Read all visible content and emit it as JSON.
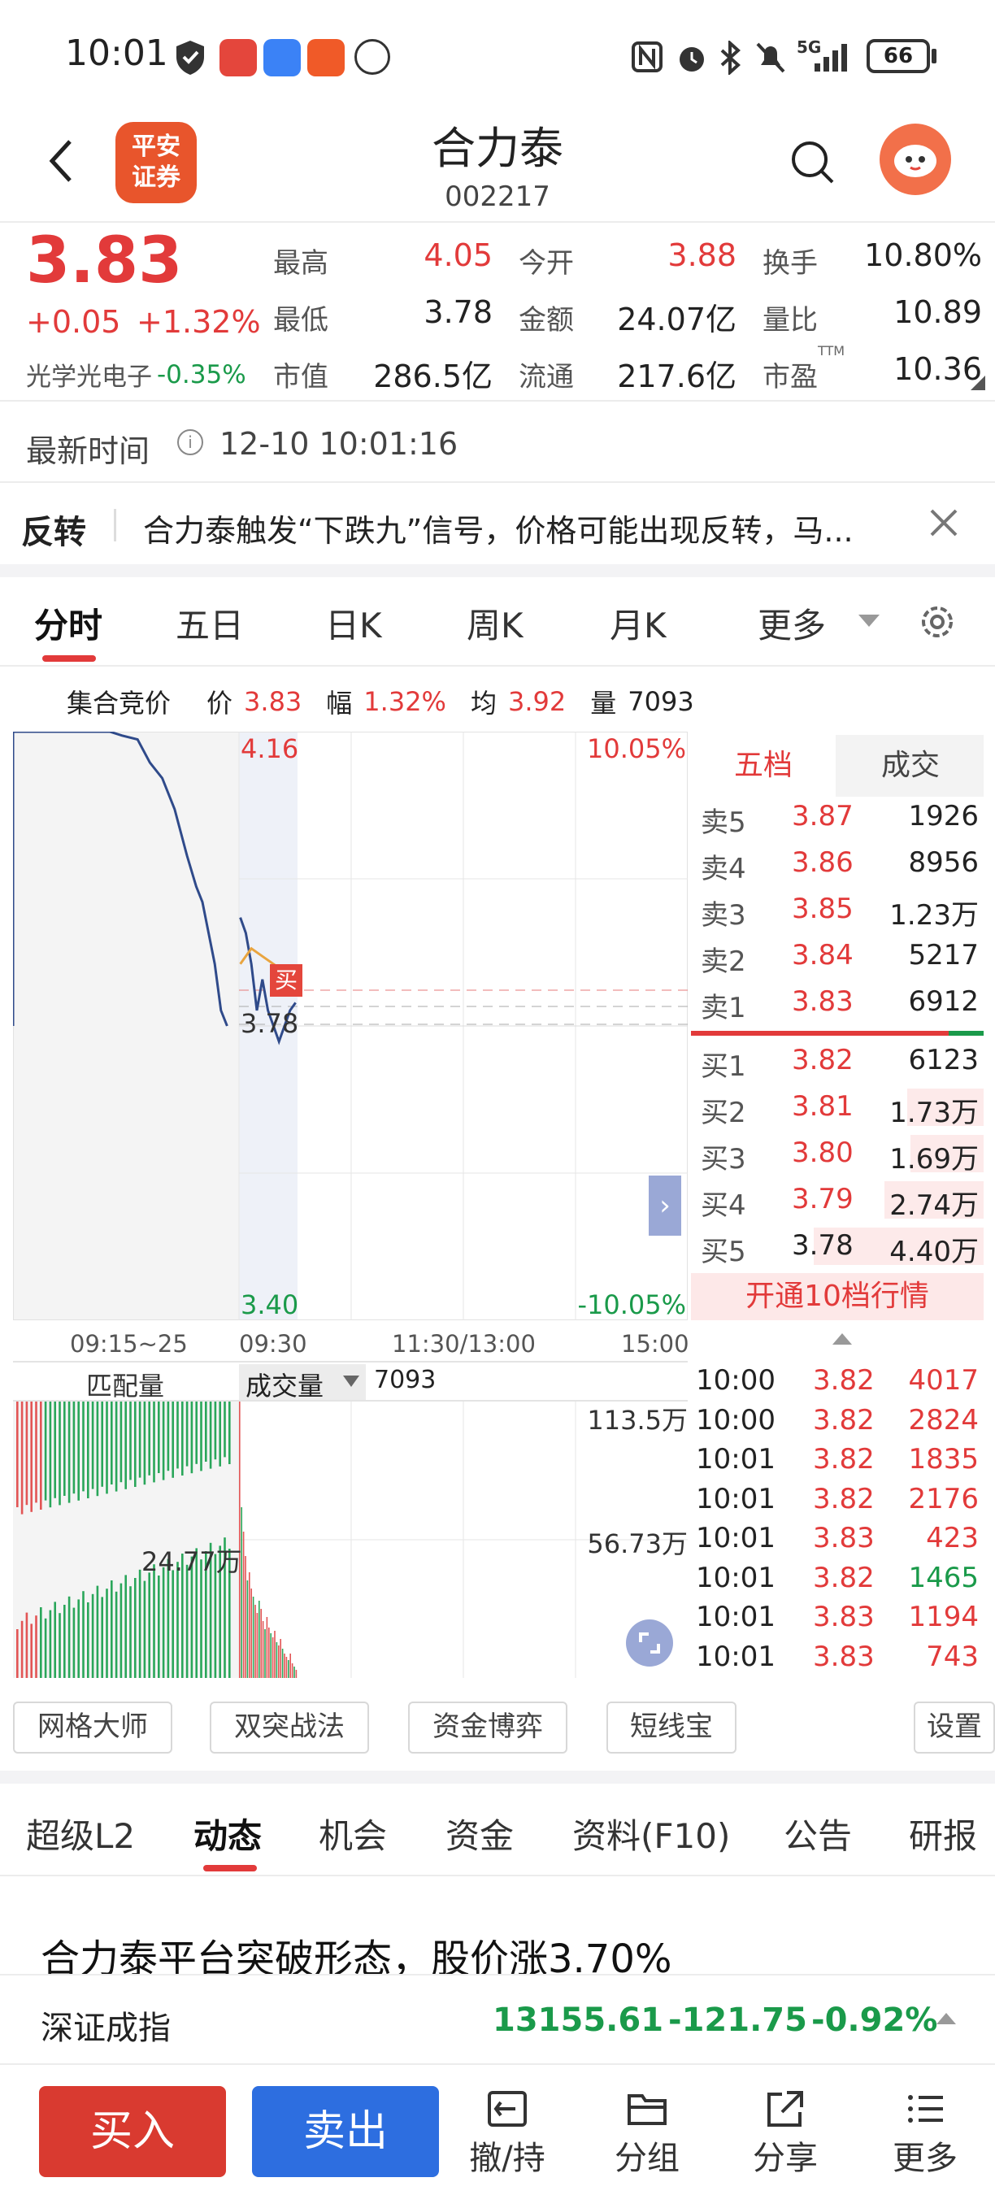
{
  "status_bar": {
    "time": "10:01",
    "battery": "66",
    "network": "5G"
  },
  "nav": {
    "stock_name": "合力泰",
    "stock_code": "002217",
    "logo_text_1": "平安",
    "logo_text_2": "证券"
  },
  "quote": {
    "price": "3.83",
    "change": "+0.05",
    "change_pct": "+1.32%",
    "sector_name": "光学光电子",
    "sector_pct": "-0.35%",
    "labels": {
      "high": "最高",
      "low": "最低",
      "mcap": "市值",
      "open": "今开",
      "amount": "金额",
      "float": "流通",
      "turnover": "换手",
      "vol_ratio": "量比",
      "pe": "市盈"
    },
    "values": {
      "high": "4.05",
      "low": "3.78",
      "mcap": "286.5亿",
      "open": "3.88",
      "amount": "24.07亿",
      "float": "217.6亿",
      "turnover": "10.80%",
      "vol_ratio": "10.89",
      "pe": "10.36"
    },
    "pe_superscript": "TTM",
    "latest_time_label": "最新时间",
    "latest_time": "12-10 10:01:16"
  },
  "news": {
    "tag": "反转",
    "text": "合力泰触发“下跌九”信号，价格可能出现反转，马..."
  },
  "chart_tabs": [
    "分时",
    "五日",
    "日K",
    "周K",
    "月K",
    "更多"
  ],
  "auction": {
    "label": "集合竞价",
    "price_label": "价",
    "price": "3.83",
    "pct_label": "幅",
    "pct": "1.32%",
    "avg_label": "均",
    "avg": "3.92",
    "vol_label": "量",
    "vol": "7093"
  },
  "chart_axis": {
    "top_price": "4.16",
    "top_pct": "10.05%",
    "bottom_price": "3.40",
    "bottom_pct": "-10.05%",
    "mark_price": "3.78",
    "buy_marker": "买",
    "times": [
      "09:15~25",
      "09:30",
      "11:30/13:00",
      "15:00"
    ]
  },
  "chart_data": {
    "type": "line",
    "title": "",
    "ylim": [
      3.4,
      4.16
    ],
    "series": [
      {
        "name": "",
        "points": [
          [
            0,
            4.16
          ],
          [
            3,
            4.16
          ],
          [
            5,
            4.16
          ],
          [
            9,
            4.155
          ],
          [
            14,
            4.15
          ],
          [
            18,
            4.12
          ],
          [
            22,
            4.1
          ],
          [
            26,
            4.06
          ],
          [
            30,
            4.0
          ],
          [
            33,
            3.96
          ],
          [
            35,
            3.94
          ],
          [
            37,
            3.9
          ],
          [
            39,
            3.86
          ],
          [
            41,
            3.8
          ],
          [
            43,
            3.78
          ]
        ]
      },
      {
        "name": "",
        "points": [
          [
            44,
            3.92
          ],
          [
            46,
            3.9
          ],
          [
            48,
            3.86
          ],
          [
            50,
            3.8
          ],
          [
            52,
            3.84
          ],
          [
            54,
            3.8
          ],
          [
            56,
            3.78
          ],
          [
            58,
            3.76
          ],
          [
            60,
            3.78
          ],
          [
            62,
            3.8
          ],
          [
            64,
            3.81
          ]
        ]
      },
      {
        "name": "",
        "points": [
          [
            44,
            3.86
          ],
          [
            48,
            3.88
          ],
          [
            52,
            3.87
          ],
          [
            56,
            3.86
          ],
          [
            60,
            3.85
          ],
          [
            62,
            3.84
          ]
        ]
      }
    ]
  },
  "order_book": {
    "tab_active": "五档",
    "tab_other": "成交",
    "asks": [
      {
        "label": "卖5",
        "price": "3.87",
        "vol": "1926"
      },
      {
        "label": "卖4",
        "price": "3.86",
        "vol": "8956"
      },
      {
        "label": "卖3",
        "price": "3.85",
        "vol": "1.23万"
      },
      {
        "label": "卖2",
        "price": "3.84",
        "vol": "5217"
      },
      {
        "label": "卖1",
        "price": "3.83",
        "vol": "6912"
      }
    ],
    "bids": [
      {
        "label": "买1",
        "price": "3.82",
        "vol": "6123"
      },
      {
        "label": "买2",
        "price": "3.81",
        "vol": "1.73万"
      },
      {
        "label": "买3",
        "price": "3.80",
        "vol": "1.69万"
      },
      {
        "label": "买4",
        "price": "3.79",
        "vol": "2.74万"
      },
      {
        "label": "买5",
        "price": "3.78",
        "vol": "4.40万"
      }
    ],
    "upgrade_text": "开通10档行情"
  },
  "volume_panel": {
    "match_label": "匹配量",
    "vol_selector": "成交量",
    "vol_value": "7093",
    "top_label": "113.5万",
    "mid_label": "56.73万",
    "auction_label": "24.77万"
  },
  "trades": [
    {
      "time": "10:00",
      "price": "3.82",
      "vol": "4017",
      "vol_color": "red"
    },
    {
      "time": "10:00",
      "price": "3.82",
      "vol": "2824",
      "vol_color": "red"
    },
    {
      "time": "10:01",
      "price": "3.82",
      "vol": "1835",
      "vol_color": "red"
    },
    {
      "time": "10:01",
      "price": "3.82",
      "vol": "2176",
      "vol_color": "red"
    },
    {
      "time": "10:01",
      "price": "3.83",
      "vol": "423",
      "vol_color": "red"
    },
    {
      "time": "10:01",
      "price": "3.82",
      "vol": "1465",
      "vol_color": "green"
    },
    {
      "time": "10:01",
      "price": "3.83",
      "vol": "1194",
      "vol_color": "red"
    },
    {
      "time": "10:01",
      "price": "3.83",
      "vol": "743",
      "vol_color": "red"
    }
  ],
  "tools": [
    "网格大师",
    "双突战法",
    "资金博弈",
    "短线宝",
    "设置"
  ],
  "info_tabs": [
    "超级L2",
    "动态",
    "机会",
    "资金",
    "资料(F10)",
    "公告",
    "研报"
  ],
  "headline": "合力泰平台突破形态，股价涨3.70%",
  "index_bar": {
    "name": "深证成指",
    "value": "13155.61",
    "change": "-121.75",
    "pct": "-0.92%"
  },
  "bottom_bar": {
    "buy": "买入",
    "sell": "卖出",
    "items": [
      "撤/持",
      "分组",
      "分享",
      "更多"
    ]
  }
}
